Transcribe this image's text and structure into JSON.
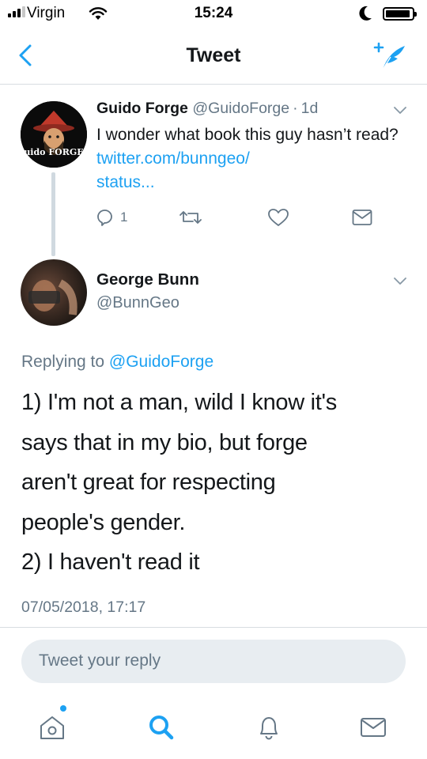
{
  "status_bar": {
    "carrier": "Virgin",
    "time": "15:24"
  },
  "nav": {
    "title": "Tweet"
  },
  "parent_tweet": {
    "name": "Guido Forge",
    "handle": "@GuidoForge",
    "separator": "·",
    "age": "1d",
    "text": "I wonder what book this guy hasn’t read?",
    "link": "twitter.com/bunngeo/",
    "link_cont": "status...",
    "reply_count": "1",
    "avatar_text": "uido FORGE"
  },
  "tweet": {
    "name": "George Bunn",
    "handle": "@BunnGeo",
    "replying_prefix": "Replying to",
    "replying_to": "@GuidoForge",
    "body": "1) I'm not a man, wild I know it's\nsays that in my bio, but forge\naren't great for respecting\npeople's gender.\n2) I haven't read it",
    "timestamp": "07/05/2018, 17:17"
  },
  "reply": {
    "placeholder": "Tweet your reply"
  },
  "tabs": [
    {
      "icon": "home-icon",
      "notification_dot": true
    },
    {
      "icon": "search-icon"
    },
    {
      "icon": "notifications-bell-icon"
    },
    {
      "icon": "messages-envelope-icon"
    }
  ],
  "colors": {
    "accent": "#1da1f2",
    "secondary_text": "#657786",
    "primary_text": "#14171a",
    "divider": "#d8dde1",
    "reply_box": "#e8edf1"
  }
}
